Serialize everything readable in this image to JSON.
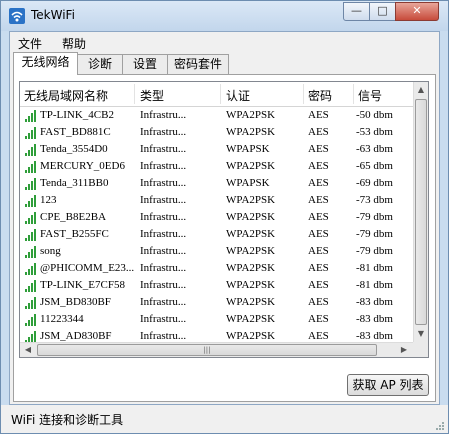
{
  "window": {
    "title": "TekWiFi",
    "min_label": "—",
    "max_label": "□",
    "close_label": "✕"
  },
  "menu": {
    "file": "文件",
    "help": "帮助"
  },
  "tabs": [
    "无线网络",
    "诊断",
    "设置",
    "密码套件"
  ],
  "table": {
    "headers": [
      "无线局域网名称",
      "类型",
      "认证",
      "密码",
      "信号"
    ],
    "rows": [
      {
        "name": "TP-LINK_4CB2",
        "type": "Infrastru...",
        "auth": "WPA2PSK",
        "cipher": "AES",
        "signal": "-50 dbm",
        "bars": 4
      },
      {
        "name": "FAST_BD881C",
        "type": "Infrastru...",
        "auth": "WPA2PSK",
        "cipher": "AES",
        "signal": "-53 dbm",
        "bars": 4
      },
      {
        "name": "Tenda_3554D0",
        "type": "Infrastru...",
        "auth": "WPAPSK",
        "cipher": "AES",
        "signal": "-63 dbm",
        "bars": 4
      },
      {
        "name": "MERCURY_0ED6",
        "type": "Infrastru...",
        "auth": "WPA2PSK",
        "cipher": "AES",
        "signal": "-65 dbm",
        "bars": 4
      },
      {
        "name": "Tenda_311BB0",
        "type": "Infrastru...",
        "auth": "WPAPSK",
        "cipher": "AES",
        "signal": "-69 dbm",
        "bars": 4
      },
      {
        "name": "123",
        "type": "Infrastru...",
        "auth": "WPA2PSK",
        "cipher": "AES",
        "signal": "-73 dbm",
        "bars": 4
      },
      {
        "name": "CPE_B8E2BA",
        "type": "Infrastru...",
        "auth": "WPA2PSK",
        "cipher": "AES",
        "signal": "-79 dbm",
        "bars": 4
      },
      {
        "name": "FAST_B255FC",
        "type": "Infrastru...",
        "auth": "WPA2PSK",
        "cipher": "AES",
        "signal": "-79 dbm",
        "bars": 4
      },
      {
        "name": "song",
        "type": "Infrastru...",
        "auth": "WPA2PSK",
        "cipher": "AES",
        "signal": "-79 dbm",
        "bars": 4
      },
      {
        "name": "@PHICOMM_E23...",
        "type": "Infrastru...",
        "auth": "WPA2PSK",
        "cipher": "AES",
        "signal": "-81 dbm",
        "bars": 4
      },
      {
        "name": "TP-LINK_E7CF58",
        "type": "Infrastru...",
        "auth": "WPA2PSK",
        "cipher": "AES",
        "signal": "-81 dbm",
        "bars": 4
      },
      {
        "name": "JSM_BD830BF",
        "type": "Infrastru...",
        "auth": "WPA2PSK",
        "cipher": "AES",
        "signal": "-83 dbm",
        "bars": 4
      },
      {
        "name": "11223344",
        "type": "Infrastru...",
        "auth": "WPA2PSK",
        "cipher": "AES",
        "signal": "-83 dbm",
        "bars": 4
      },
      {
        "name": "JSM_AD830BF",
        "type": "Infrastru...",
        "auth": "WPA2PSK",
        "cipher": "AES",
        "signal": "-83 dbm",
        "bars": 4
      },
      {
        "name": "",
        "type": "",
        "auth": "",
        "cipher": "",
        "signal": "",
        "bars": 4
      }
    ]
  },
  "buttons": {
    "refresh": "获取 AP 列表"
  },
  "status": {
    "text": "WiFi 连接和诊断工具"
  },
  "colors": {
    "signal_bar": "#2f9e3a",
    "title_bar": "#c2d6ec",
    "close": "#c74b3b"
  },
  "icons": {
    "app": "wifi-app-icon",
    "signal": "signal-strength-icon"
  }
}
